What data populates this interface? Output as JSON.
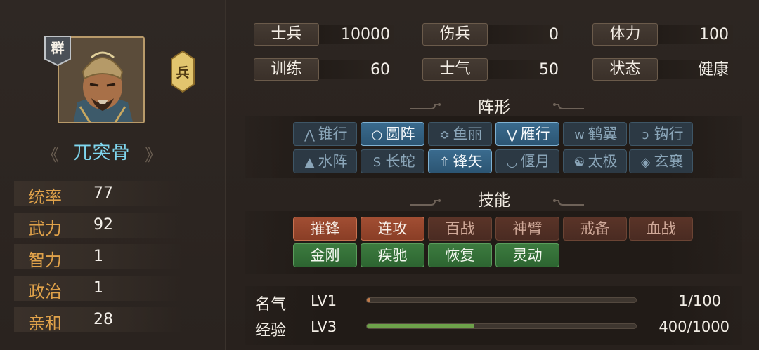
{
  "hero": {
    "faction": "群",
    "unit_type": "兵",
    "name": "兀突骨",
    "name_deco_left": "《",
    "name_deco_right": "》",
    "stats": [
      {
        "label": "统率",
        "value": "77"
      },
      {
        "label": "武力",
        "value": "92"
      },
      {
        "label": "智力",
        "value": "1"
      },
      {
        "label": "政治",
        "value": "1"
      },
      {
        "label": "亲和",
        "value": "28"
      }
    ]
  },
  "troop_info": [
    {
      "label": "士兵",
      "value": "10000"
    },
    {
      "label": "伤兵",
      "value": "0"
    },
    {
      "label": "体力",
      "value": "100"
    },
    {
      "label": "训练",
      "value": "60"
    },
    {
      "label": "士气",
      "value": "50"
    },
    {
      "label": "状态",
      "value": "健康"
    }
  ],
  "formation": {
    "title": "阵形",
    "items": [
      {
        "glyph": "⋀",
        "label": "锥行",
        "active": false
      },
      {
        "glyph": "○",
        "label": "圆阵",
        "active": true
      },
      {
        "glyph": "≎",
        "label": "鱼丽",
        "active": false
      },
      {
        "glyph": "⋁",
        "label": "雁行",
        "active": true
      },
      {
        "glyph": "ᴡ",
        "label": "鹤翼",
        "active": false
      },
      {
        "glyph": "ↄ",
        "label": "钩行",
        "active": false
      },
      {
        "glyph": "▲",
        "label": "水阵",
        "active": false
      },
      {
        "glyph": "S",
        "label": "长蛇",
        "active": false
      },
      {
        "glyph": "⇧",
        "label": "锋矢",
        "active": true
      },
      {
        "glyph": "◡",
        "label": "偃月",
        "active": false
      },
      {
        "glyph": "☯",
        "label": "太极",
        "active": false
      },
      {
        "glyph": "◈",
        "label": "玄襄",
        "active": false
      }
    ]
  },
  "skills": {
    "title": "技能",
    "items": [
      {
        "label": "摧锋",
        "style": "red"
      },
      {
        "label": "连攻",
        "style": "red"
      },
      {
        "label": "百战",
        "style": "red-dim"
      },
      {
        "label": "神臂",
        "style": "red-dim"
      },
      {
        "label": "戒备",
        "style": "red-dim"
      },
      {
        "label": "血战",
        "style": "red-dim"
      },
      {
        "label": "金刚",
        "style": "green"
      },
      {
        "label": "疾驰",
        "style": "green"
      },
      {
        "label": "恢复",
        "style": "green"
      },
      {
        "label": "灵动",
        "style": "green"
      }
    ]
  },
  "progress": [
    {
      "label": "名气",
      "level": "LV1",
      "value": "1/100",
      "fraction": 0.01,
      "color": "#c07a4a"
    },
    {
      "label": "经验",
      "level": "LV3",
      "value": "400/1000",
      "fraction": 0.4,
      "color": "#6da14a"
    }
  ]
}
